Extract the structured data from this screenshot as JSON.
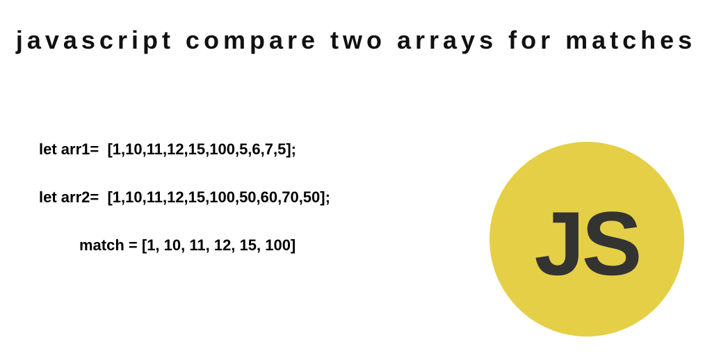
{
  "title": "javascript compare two arrays for matches",
  "code": {
    "line1": "let arr1=  [1,10,11,12,15,100,5,6,7,5];",
    "line2": "let arr2=  [1,10,11,12,15,100,50,60,70,50];",
    "result": "match = [1, 10, 11, 12, 15, 100]"
  },
  "badge": {
    "label": "JS"
  }
}
